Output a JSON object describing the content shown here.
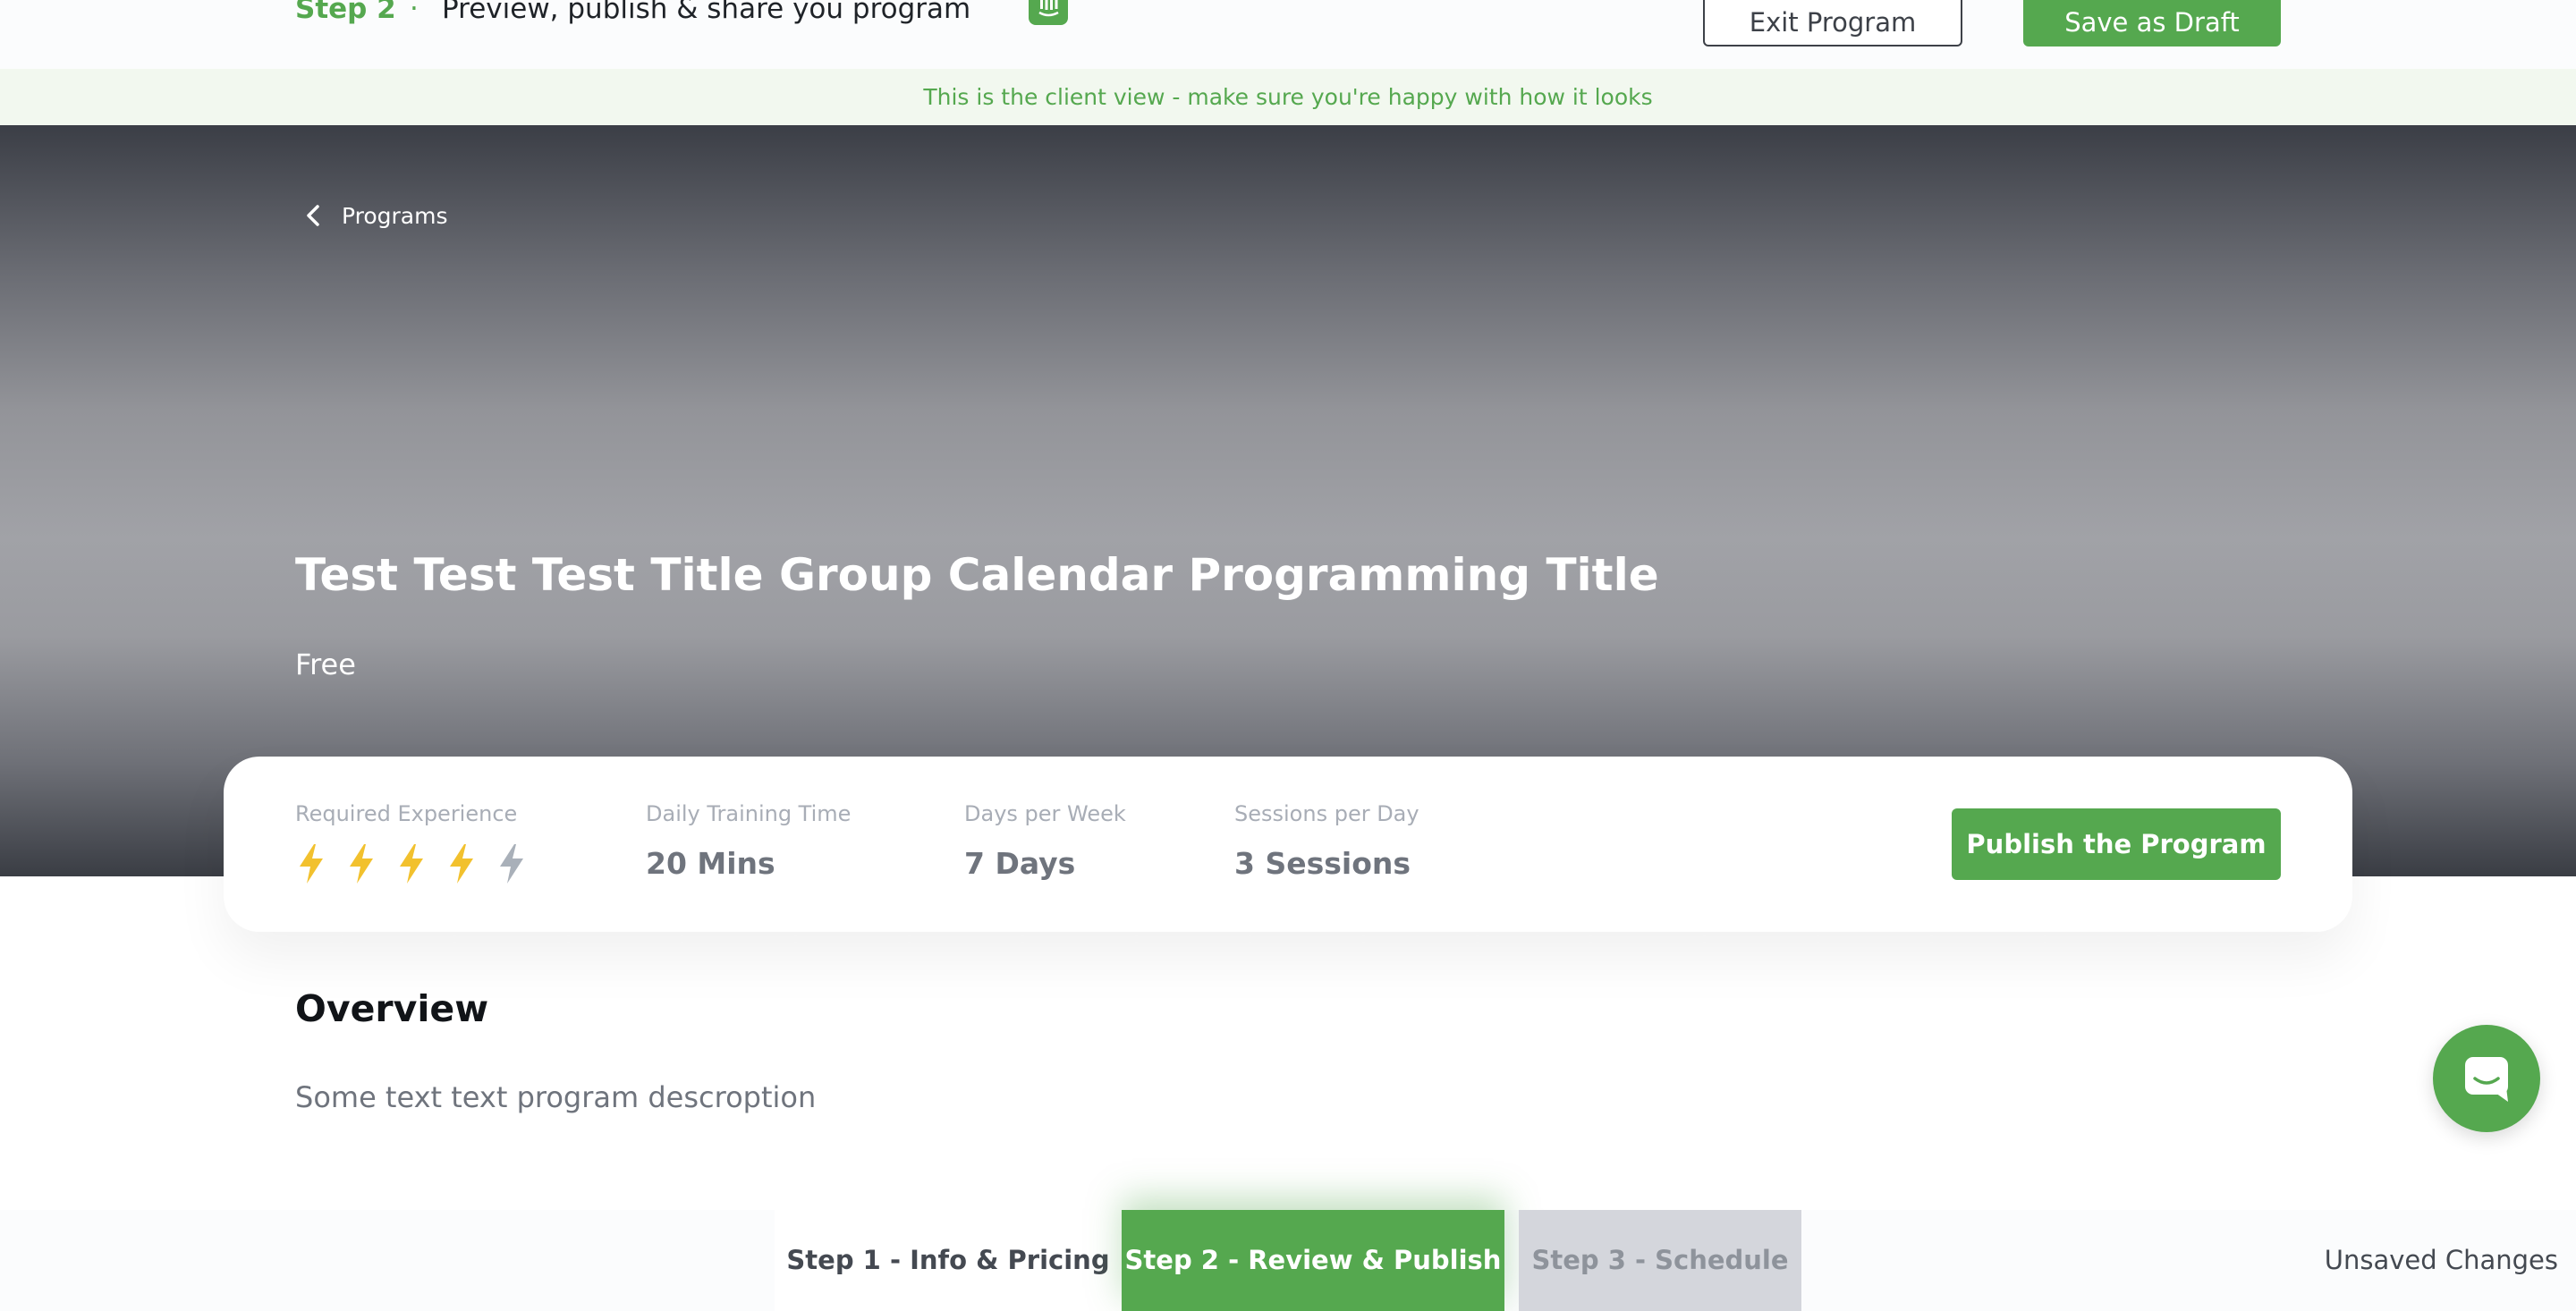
{
  "topbar": {
    "step_label": "Step 2",
    "step_dot": "·",
    "step_title": "Preview, publish & share you program",
    "exit_label": "Exit Program",
    "draft_label": "Save as Draft"
  },
  "banner": {
    "text": "This is the client view - make sure you're happy with how it looks"
  },
  "hero": {
    "back_label": "Programs",
    "title": "Test Test Test Title Group Calendar Programming Title",
    "price": "Free"
  },
  "stats": {
    "experience": {
      "label": "Required Experience",
      "level": 4,
      "max": 5
    },
    "training_time": {
      "label": "Daily Training Time",
      "value": "20 Mins"
    },
    "days_per_week": {
      "label": "Days per Week",
      "value": "7 Days"
    },
    "sessions_per_day": {
      "label": "Sessions per Day",
      "value": "3 Sessions"
    },
    "publish_label": "Publish the Program"
  },
  "overview": {
    "title": "Overview",
    "text": "Some text text program descroption"
  },
  "bottom_steps": {
    "step1": "Step 1 - Info & Pricing",
    "step2": "Step 2 - Review & Publish",
    "step3": "Step 3 - Schedule",
    "status": "Unsaved Changes"
  },
  "colors": {
    "accent": "#55a84f",
    "bolt_active": "#f2c12e",
    "bolt_inactive": "#a9b0b9"
  },
  "icons": {
    "topbar": "intercom-icon",
    "back": "chevron-left-icon",
    "experience": "lightning-bolt-icon",
    "chat": "chat-bubble-icon"
  }
}
